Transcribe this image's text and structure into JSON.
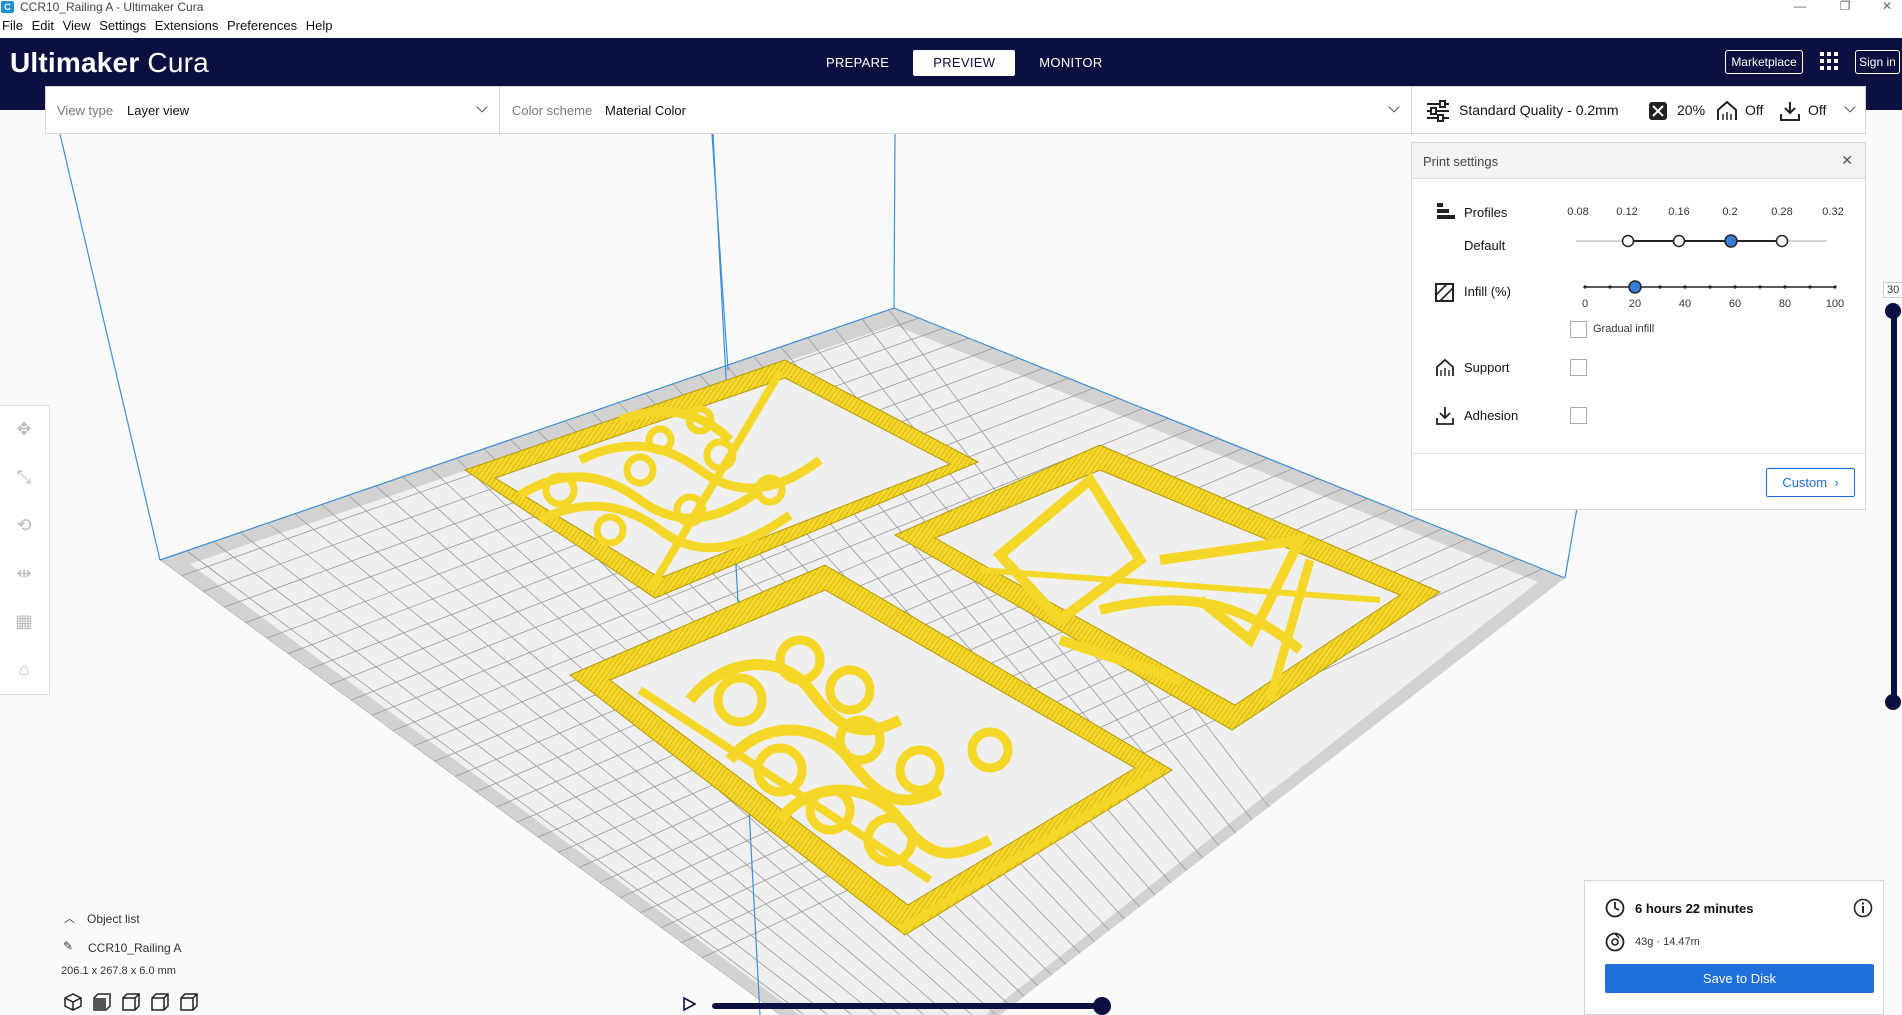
{
  "window": {
    "title": "CCR10_Railing A - Ultimaker Cura",
    "app_icon": "C",
    "controls": [
      "minimize-icon",
      "restore-icon",
      "close-icon"
    ]
  },
  "menu": [
    "File",
    "Edit",
    "View",
    "Settings",
    "Extensions",
    "Preferences",
    "Help"
  ],
  "header": {
    "logo_bold": "Ultimaker",
    "logo_light": " Cura",
    "stages": [
      "PREPARE",
      "PREVIEW",
      "MONITOR"
    ],
    "active_stage": "PREVIEW",
    "marketplace_label": "Marketplace",
    "signin_label": "Sign in"
  },
  "view_type": {
    "label": "View type",
    "value": "Layer view"
  },
  "color_scheme": {
    "label": "Color scheme",
    "value": "Material Color"
  },
  "quality_bar": {
    "profile": "Standard Quality - 0.2mm",
    "infill": "20%",
    "support": "Off",
    "adhesion": "Off"
  },
  "print_settings": {
    "title": "Print settings",
    "profiles_label": "Profiles",
    "default_label": "Default",
    "profile_ticks": [
      "0.08",
      "0.12",
      "0.16",
      "0.2",
      "0.28",
      "0.32"
    ],
    "selected_profile": "0.2",
    "infill_label": "Infill (%)",
    "infill_ticks": [
      "0",
      "20",
      "40",
      "60",
      "80",
      "100"
    ],
    "infill_value": 20,
    "gradual_infill_label": "Gradual infill",
    "support_label": "Support",
    "adhesion_label": "Adhesion",
    "custom_label": "Custom"
  },
  "layer_slider": {
    "value": "30"
  },
  "object_list": {
    "header": "Object list",
    "object_name": "CCR10_Railing A",
    "dimensions": "206.1 x 267.8 x 6.0 mm"
  },
  "estimate": {
    "time": "6 hours 22 minutes",
    "material": "43g · 14.47m",
    "save_label": "Save to Disk"
  },
  "colors": {
    "header_bg": "#0b1040",
    "accent_blue": "#1e6fd9",
    "model_yellow": "#f5d728",
    "grid_lines": "#9a9a9a",
    "build_volume_lines": "#3d8fd8"
  }
}
